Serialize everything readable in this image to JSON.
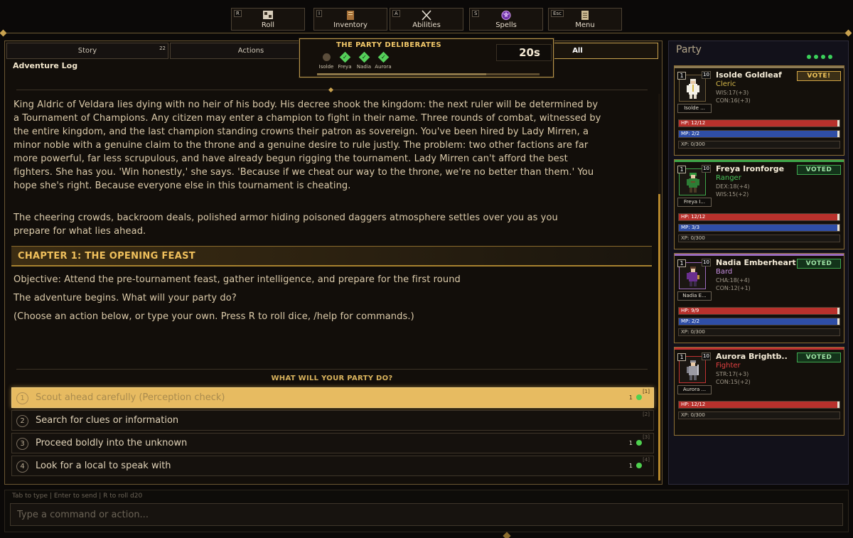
{
  "toolbar": {
    "buttons": [
      {
        "hotkey": "R",
        "label": "Roll",
        "icon": "dice-icon"
      },
      {
        "hotkey": "I",
        "label": "Inventory",
        "icon": "book-icon"
      },
      {
        "hotkey": "A",
        "label": "Abilities",
        "icon": "crossed-swords-icon"
      },
      {
        "hotkey": "S",
        "label": "Spells",
        "icon": "magic-orb-icon"
      },
      {
        "hotkey": "Esc",
        "label": "Menu",
        "icon": "scroll-icon"
      }
    ]
  },
  "tabs": [
    {
      "label": "Story",
      "count": "22"
    },
    {
      "label": "Actions"
    },
    {
      "label": "All",
      "active": true
    }
  ],
  "deliberation": {
    "title": "THE PARTY DELIBERATES",
    "timer": "20s",
    "progress": 0.76,
    "members": [
      {
        "name": "Isolde",
        "status": "waiting"
      },
      {
        "name": "Freya",
        "status": "voted"
      },
      {
        "name": "Nadia",
        "status": "voted"
      },
      {
        "name": "Aurora",
        "status": "voted"
      }
    ]
  },
  "log": {
    "title": "Adventure Log",
    "intro": "King Aldric of Veldara lies dying with no heir of his body. His decree shook the kingdom: the next ruler will be determined by a Tournament of Champions. Any citizen may enter a champion to fight in their name. Three rounds of combat, witnessed by the entire kingdom, and the last champion standing crowns their patron as sovereign. You've been hired by Lady Mirren, a minor noble with a genuine claim to the throne and a genuine desire to rule justly. The problem: two other factions are far more powerful, far less scrupulous, and have already begun rigging the tournament. Lady Mirren can't afford the best fighters. She has you. 'Win honestly,' she says. 'Because if we cheat our way to the throne, we're no better than them.' You hope she's right. Because everyone else in this tournament is cheating.",
    "atmosphere": "The cheering crowds, backroom deals, polished armor hiding poisoned daggers atmosphere settles over you as you prepare for what lies ahead.",
    "chapter": "CHAPTER 1: THE OPENING FEAST",
    "objective": "Objective: Attend the pre-tournament feast, gather intelligence, and prepare for the first round",
    "begins": "The adventure begins. What will your party do?",
    "hint": "(Choose an action below, or type your own. Press R to roll dice, /help for commands.)"
  },
  "prompt": {
    "title": "WHAT WILL YOUR PARTY DO?",
    "choices": [
      {
        "num": "1",
        "text": "Scout ahead carefully (Perception check)",
        "votes": "1",
        "key": "[1]",
        "selected": true
      },
      {
        "num": "2",
        "text": "Search for clues or information",
        "votes": "",
        "key": "[2]"
      },
      {
        "num": "3",
        "text": "Proceed boldly into the unknown",
        "votes": "1",
        "key": "[3]"
      },
      {
        "num": "4",
        "text": "Look for a local to speak with",
        "votes": "1",
        "key": "[4]"
      }
    ]
  },
  "party": {
    "title": "Party",
    "members": [
      {
        "name": "Isolde Goldleaf",
        "tag": "Isolde ...",
        "class": "Cleric",
        "class_color": "#d6b94a",
        "band": "#8b7a55",
        "level": "1",
        "next": "10",
        "stats": [
          "WIS:17(+3)",
          "CON:16(+3)"
        ],
        "vote": "VOTE!",
        "voted": false,
        "hp": "HP: 12/12",
        "hp_frac": 1.0,
        "mp": "MP: 2/2",
        "mp_frac": 1.0,
        "xp": "XP: 0/300"
      },
      {
        "name": "Freya Ironforge",
        "tag": "Freya I...",
        "class": "Ranger",
        "class_color": "#49c35a",
        "band": "#3ea54a",
        "level": "1",
        "next": "10",
        "stats": [
          "DEX:18(+4)",
          "WIS:15(+2)"
        ],
        "vote": "VOTED",
        "voted": true,
        "hp": "HP: 12/12",
        "hp_frac": 1.0,
        "mp": "MP: 3/3",
        "mp_frac": 1.0,
        "xp": "XP: 0/300"
      },
      {
        "name": "Nadia Emberheart",
        "tag": "Nadia E...",
        "class": "Bard",
        "class_color": "#c58ee0",
        "band": "#9b6bbd",
        "level": "1",
        "next": "10",
        "stats": [
          "CHA:18(+4)",
          "CON:12(+1)"
        ],
        "vote": "VOTED",
        "voted": true,
        "hp": "HP: 9/9",
        "hp_frac": 1.0,
        "mp": "MP: 2/2",
        "mp_frac": 1.0,
        "xp": "XP: 0/300"
      },
      {
        "name": "Aurora Brightb..",
        "tag": "Aurora ...",
        "class": "Fighter",
        "class_color": "#e04040",
        "band": "#c03232",
        "level": "1",
        "next": "10",
        "stats": [
          "STR:17(+3)",
          "CON:15(+2)"
        ],
        "vote": "VOTED",
        "voted": true,
        "hp": "HP: 12/12",
        "hp_frac": 1.0,
        "mp": null,
        "xp": "XP: 0/300"
      }
    ]
  },
  "input": {
    "hint": "Tab to type | Enter to send | R to roll d20",
    "placeholder": "Type a command or action..."
  }
}
